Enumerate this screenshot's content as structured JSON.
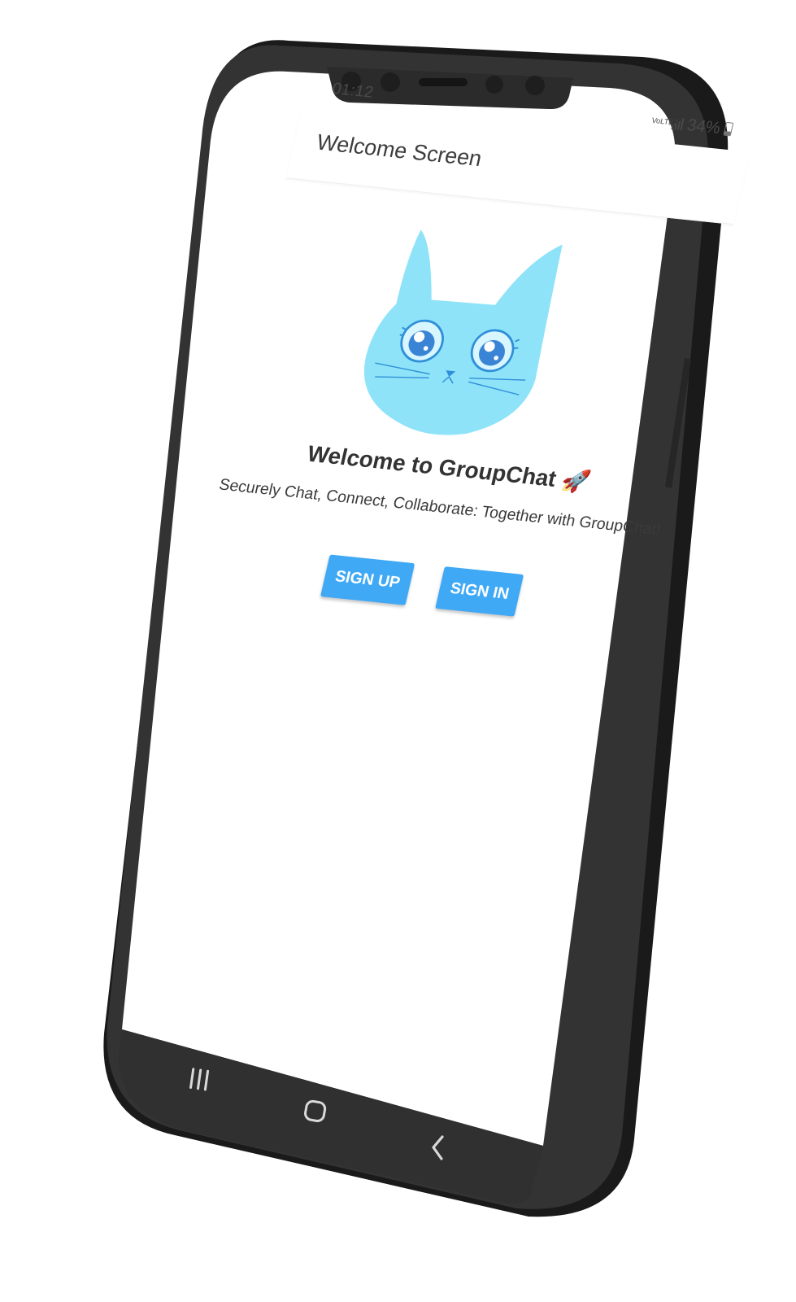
{
  "status_bar": {
    "time": "01:12",
    "network": "VoLTE2",
    "battery": "34%"
  },
  "app_bar": {
    "title": "Welcome Screen"
  },
  "welcome": {
    "title": "Welcome to GroupChat 🚀",
    "subtitle": "Securely Chat, Connect, Collaborate: Together with GroupChat!"
  },
  "buttons": {
    "sign_up": "SIGN UP",
    "sign_in": "SIGN IN"
  },
  "icons": {
    "logo": "cat-face-icon",
    "recent_apps": "recent-apps-icon",
    "home": "home-icon",
    "back": "back-icon"
  },
  "colors": {
    "accent": "#3fa9f5",
    "cat": "#8fe3f9",
    "phone_frame": "#2b2b2b"
  }
}
